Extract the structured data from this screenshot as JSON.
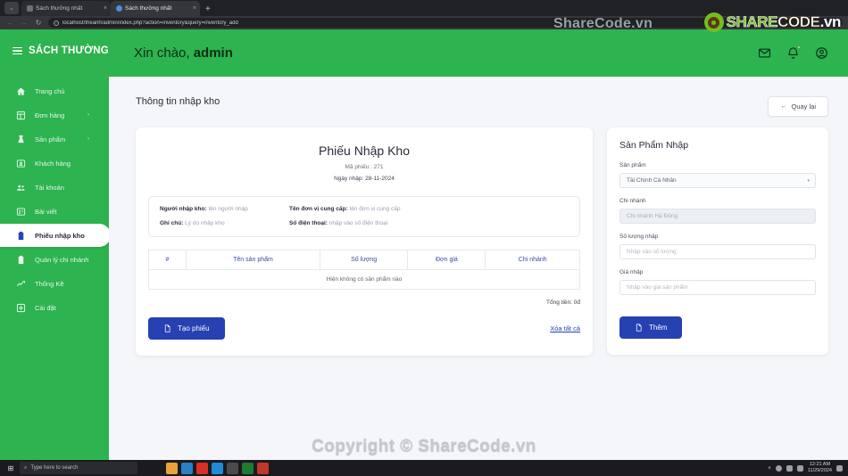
{
  "browser": {
    "tabs": [
      {
        "title": "Sách thưởng nhất",
        "close": "×",
        "active": false
      },
      {
        "title": "Sách thưởng nhất",
        "close": "×",
        "active": true
      }
    ],
    "new_tab_label": "+",
    "menu_glyph": "⌄",
    "nav": {
      "back": "←",
      "forward": "→",
      "reload": "↻"
    },
    "omnibox": {
      "url": "localhost/theanh/admin/index.php?action=inventory&query=inventory_add",
      "info_glyph": "ⓘ"
    }
  },
  "sidebar": {
    "brand": "SÁCH THƯỜNG I",
    "items": [
      {
        "label": "Trang chủ",
        "icon": "home-icon",
        "caret": "",
        "active": false
      },
      {
        "label": "Đơn hàng",
        "icon": "grid-icon",
        "caret": "›",
        "active": false
      },
      {
        "label": "Sản phẩm",
        "icon": "product-icon",
        "caret": "›",
        "active": false
      },
      {
        "label": "Khách hàng",
        "icon": "id-card-icon",
        "caret": "",
        "active": false
      },
      {
        "label": "Tài khoản",
        "icon": "users-icon",
        "caret": "",
        "active": false
      },
      {
        "label": "Bài viết",
        "icon": "article-icon",
        "caret": "",
        "active": false
      },
      {
        "label": "Phiếu nhập kho",
        "icon": "clipboard-icon",
        "caret": "",
        "active": true
      },
      {
        "label": "Quản lý chi nhánh",
        "icon": "clipboard-icon",
        "caret": "",
        "active": false
      },
      {
        "label": "Thống Kê",
        "icon": "chart-line-icon",
        "caret": "",
        "active": false
      },
      {
        "label": "Cài đặt",
        "icon": "settings-icon",
        "caret": "",
        "active": false
      }
    ]
  },
  "topbar": {
    "greeting_prefix": "Xin chào, ",
    "user": "admin",
    "icons": [
      {
        "name": "mail-icon"
      },
      {
        "name": "bell-icon"
      },
      {
        "name": "user-circle-icon"
      }
    ]
  },
  "content": {
    "page_title": "Thông tin nhập kho",
    "back_button": {
      "label": "Quay lại",
      "arrow": "←"
    }
  },
  "receipt": {
    "title": "Phiếu Nhập Kho",
    "code_line": "Mã phiếu : 271",
    "date_line": "Ngày nhập: 28-11-2024",
    "info": [
      {
        "label": "Người nhập kho:",
        "value": "tên người nhập"
      },
      {
        "label": "Tên đơn vị cung cấp:",
        "value": "tên đơn vị cung cấp"
      },
      {
        "label": "Ghi chú:",
        "value": "Lý do nhập kho"
      },
      {
        "label": "Số điện thoại:",
        "value": "nhập vào số điện thoại"
      }
    ],
    "table": {
      "headers": [
        "#",
        "Tên sản phẩm",
        "Số lượng",
        "Đơn giá",
        "Chi nhánh"
      ],
      "empty_message": "Hiện không có sản phẩm nào"
    },
    "total": "Tổng tiền: 0đ",
    "create_button": "Tạo phiếu",
    "clear_link": "Xóa tất cả"
  },
  "product_panel": {
    "title": "Sản Phẩm Nhập",
    "fields": [
      {
        "label": "Sản phẩm",
        "value": "Tài Chính Cá Nhân",
        "type": "select",
        "chevron": "▾"
      },
      {
        "label": "Chi nhánh",
        "value": "Chi nhánh Hà Đông",
        "type": "disabled"
      },
      {
        "label": "Số lượng nhập",
        "placeholder": "Nhập vào số lượng",
        "type": "input"
      },
      {
        "label": "Giá nhập",
        "placeholder": "Nhập vào giá sản phẩm",
        "type": "input"
      }
    ],
    "add_button": "Thêm"
  },
  "watermarks": {
    "top_text": "ShareCode.vn",
    "logo_share": "SHARE",
    "logo_code": "CODE",
    "logo_vn": ".vn",
    "bottom_text": "Copyright © ShareCode.vn"
  },
  "taskbar": {
    "start_glyph": "⊞",
    "search_placeholder": "Type here to search",
    "search_glyph": "⌕",
    "time": "12:21 AM",
    "date": "11/29/2024",
    "chevron": "∧"
  },
  "colors": {
    "brand_green": "#2db34f",
    "primary_blue": "#2541b2",
    "header_blue": "#3a4a9e",
    "page_bg": "#f4f6f9"
  }
}
